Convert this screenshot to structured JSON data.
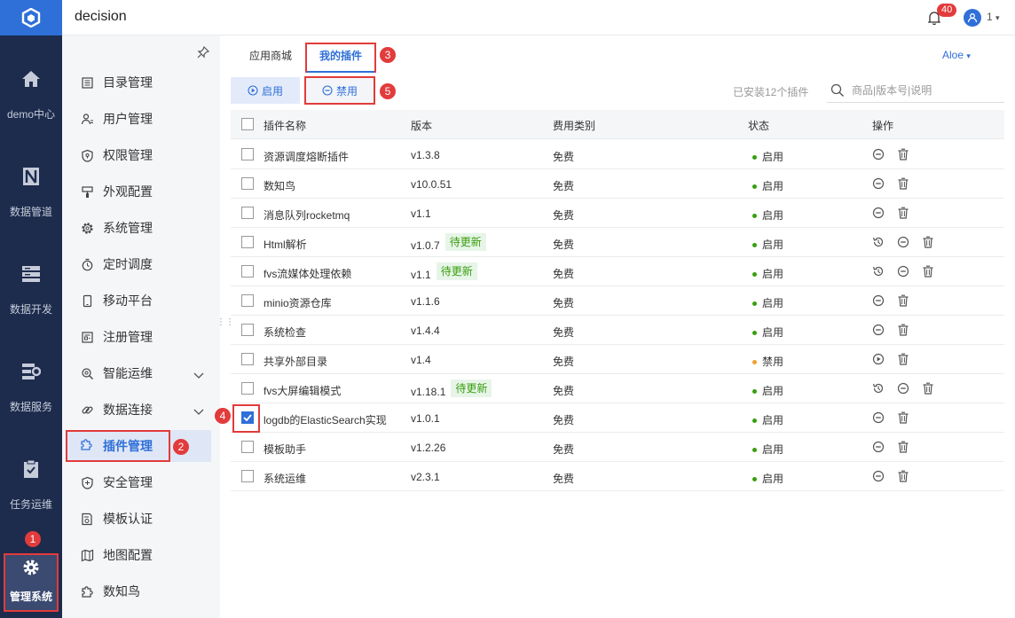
{
  "app": {
    "title": "decision"
  },
  "topbar": {
    "notification_count": "40",
    "user_name": "1"
  },
  "rail": {
    "items": [
      {
        "label": "demo中心",
        "icon": "home-icon"
      },
      {
        "label": "数据管道",
        "icon": "pipeline-icon"
      },
      {
        "label": "数据开发",
        "icon": "server-icon"
      },
      {
        "label": "数据服务",
        "icon": "service-icon"
      },
      {
        "label": "任务运维",
        "icon": "clipboard-check-icon"
      },
      {
        "label": "管理系统",
        "icon": "gear-icon",
        "active": true
      }
    ]
  },
  "sidebar": {
    "items": [
      {
        "label": "目录管理",
        "icon": "list-icon"
      },
      {
        "label": "用户管理",
        "icon": "user-icon"
      },
      {
        "label": "权限管理",
        "icon": "shield-icon"
      },
      {
        "label": "外观配置",
        "icon": "brush-icon"
      },
      {
        "label": "系统管理",
        "icon": "gear-icon"
      },
      {
        "label": "定时调度",
        "icon": "clock-icon"
      },
      {
        "label": "移动平台",
        "icon": "phone-icon"
      },
      {
        "label": "注册管理",
        "icon": "register-icon"
      },
      {
        "label": "智能运维",
        "icon": "search-gear-icon",
        "expandable": true
      },
      {
        "label": "数据连接",
        "icon": "link-icon",
        "expandable": true
      },
      {
        "label": "插件管理",
        "icon": "puzzle-icon",
        "active": true
      },
      {
        "label": "安全管理",
        "icon": "shield-plus-icon"
      },
      {
        "label": "模板认证",
        "icon": "certificate-icon"
      },
      {
        "label": "地图配置",
        "icon": "map-icon"
      },
      {
        "label": "数知鸟",
        "icon": "puzzle-icon"
      }
    ]
  },
  "callouts": [
    "1",
    "2",
    "3",
    "4",
    "5"
  ],
  "tabs": {
    "store": "应用商城",
    "mine": "我的插件",
    "lang": "Aloe"
  },
  "toolbar": {
    "enable_label": "启用",
    "disable_label": "禁用",
    "installed_text": "已安装12个插件",
    "search_placeholder": "商品|版本号|说明"
  },
  "table": {
    "headers": {
      "name": "插件名称",
      "version": "版本",
      "fee": "费用类别",
      "status": "状态",
      "ops": "操作"
    },
    "update_tag": "待更新",
    "rows": [
      {
        "name": "资源调度熔断插件",
        "version": "v1.3.8",
        "fee": "免费",
        "status": "启用",
        "status_color": "#389e0d",
        "update": false,
        "checked": false,
        "ops": [
          "disable",
          "delete"
        ]
      },
      {
        "name": "数知鸟",
        "version": "v10.0.51",
        "fee": "免费",
        "status": "启用",
        "status_color": "#389e0d",
        "update": false,
        "checked": false,
        "ops": [
          "disable",
          "delete"
        ]
      },
      {
        "name": "消息队列rocketmq",
        "version": "v1.1",
        "fee": "免费",
        "status": "启用",
        "status_color": "#389e0d",
        "update": false,
        "checked": false,
        "ops": [
          "disable",
          "delete"
        ]
      },
      {
        "name": "Html解析",
        "version": "v1.0.7",
        "fee": "免费",
        "status": "启用",
        "status_color": "#389e0d",
        "update": true,
        "checked": false,
        "ops": [
          "update",
          "disable",
          "delete"
        ]
      },
      {
        "name": "fvs流媒体处理依赖",
        "version": "v1.1",
        "fee": "免费",
        "status": "启用",
        "status_color": "#389e0d",
        "update": true,
        "checked": false,
        "ops": [
          "update",
          "disable",
          "delete"
        ]
      },
      {
        "name": "minio资源仓库",
        "version": "v1.1.6",
        "fee": "免费",
        "status": "启用",
        "status_color": "#389e0d",
        "update": false,
        "checked": false,
        "ops": [
          "disable",
          "delete"
        ]
      },
      {
        "name": "系统检查",
        "version": "v1.4.4",
        "fee": "免费",
        "status": "启用",
        "status_color": "#389e0d",
        "update": false,
        "checked": false,
        "ops": [
          "disable",
          "delete"
        ]
      },
      {
        "name": "共享外部目录",
        "version": "v1.4",
        "fee": "免费",
        "status": "禁用",
        "status_color": "#f0a030",
        "update": false,
        "checked": false,
        "ops": [
          "enable",
          "delete"
        ]
      },
      {
        "name": "fvs大屏编辑模式",
        "version": "v1.18.1",
        "fee": "免费",
        "status": "启用",
        "status_color": "#389e0d",
        "update": true,
        "checked": false,
        "ops": [
          "update",
          "disable",
          "delete"
        ]
      },
      {
        "name": "logdb的ElasticSearch实现",
        "version": "v1.0.1",
        "fee": "免费",
        "status": "启用",
        "status_color": "#389e0d",
        "update": false,
        "checked": true,
        "ops": [
          "disable",
          "delete"
        ]
      },
      {
        "name": "模板助手",
        "version": "v1.2.26",
        "fee": "免费",
        "status": "启用",
        "status_color": "#389e0d",
        "update": false,
        "checked": false,
        "ops": [
          "disable",
          "delete"
        ]
      },
      {
        "name": "系统运维",
        "version": "v2.3.1",
        "fee": "免费",
        "status": "启用",
        "status_color": "#389e0d",
        "update": false,
        "checked": false,
        "ops": [
          "disable",
          "delete"
        ]
      }
    ]
  },
  "colors": {
    "accent": "#2f6fd8",
    "rail_bg": "#1d2b4d",
    "highlight": "#e23b3b",
    "enabled": "#389e0d",
    "disabled": "#f0a030"
  }
}
